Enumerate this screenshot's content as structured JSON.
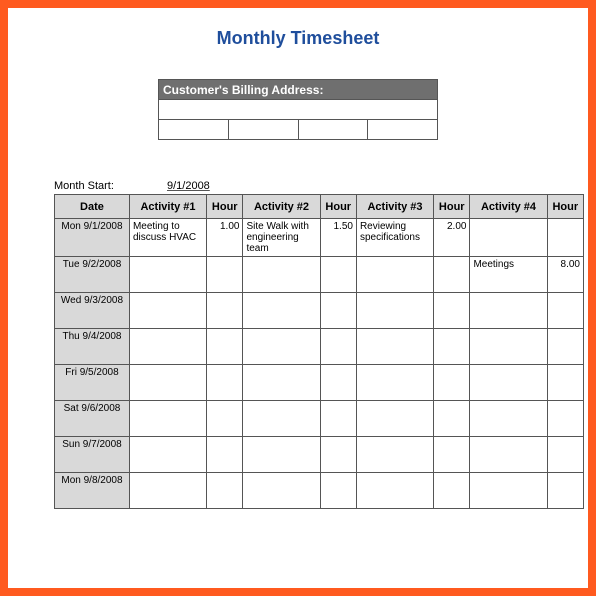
{
  "title": "Monthly Timesheet",
  "billing": {
    "header": "Customer's Billing Address:"
  },
  "month_start": {
    "label": "Month Start:",
    "value": "9/1/2008"
  },
  "headers": {
    "date": "Date",
    "activity1": "Activity #1",
    "hour1": "Hour",
    "activity2": "Activity #2",
    "hour2": "Hour",
    "activity3": "Activity #3",
    "hour3": "Hour",
    "activity4": "Activity #4",
    "hour4": "Hour"
  },
  "rows": [
    {
      "date": "Mon 9/1/2008",
      "act1": "Meeting to discuss HVAC",
      "h1": "1.00",
      "act2": "Site Walk with engineering team",
      "h2": "1.50",
      "act3": "Reviewing specifications",
      "h3": "2.00",
      "act4": "",
      "h4": ""
    },
    {
      "date": "Tue 9/2/2008",
      "act1": "",
      "h1": "",
      "act2": "",
      "h2": "",
      "act3": "",
      "h3": "",
      "act4": "Meetings",
      "h4": "8.00"
    },
    {
      "date": "Wed 9/3/2008",
      "act1": "",
      "h1": "",
      "act2": "",
      "h2": "",
      "act3": "",
      "h3": "",
      "act4": "",
      "h4": ""
    },
    {
      "date": "Thu 9/4/2008",
      "act1": "",
      "h1": "",
      "act2": "",
      "h2": "",
      "act3": "",
      "h3": "",
      "act4": "",
      "h4": ""
    },
    {
      "date": "Fri 9/5/2008",
      "act1": "",
      "h1": "",
      "act2": "",
      "h2": "",
      "act3": "",
      "h3": "",
      "act4": "",
      "h4": ""
    },
    {
      "date": "Sat 9/6/2008",
      "act1": "",
      "h1": "",
      "act2": "",
      "h2": "",
      "act3": "",
      "h3": "",
      "act4": "",
      "h4": ""
    },
    {
      "date": "Sun 9/7/2008",
      "act1": "",
      "h1": "",
      "act2": "",
      "h2": "",
      "act3": "",
      "h3": "",
      "act4": "",
      "h4": ""
    },
    {
      "date": "Mon 9/8/2008",
      "act1": "",
      "h1": "",
      "act2": "",
      "h2": "",
      "act3": "",
      "h3": "",
      "act4": "",
      "h4": ""
    }
  ]
}
